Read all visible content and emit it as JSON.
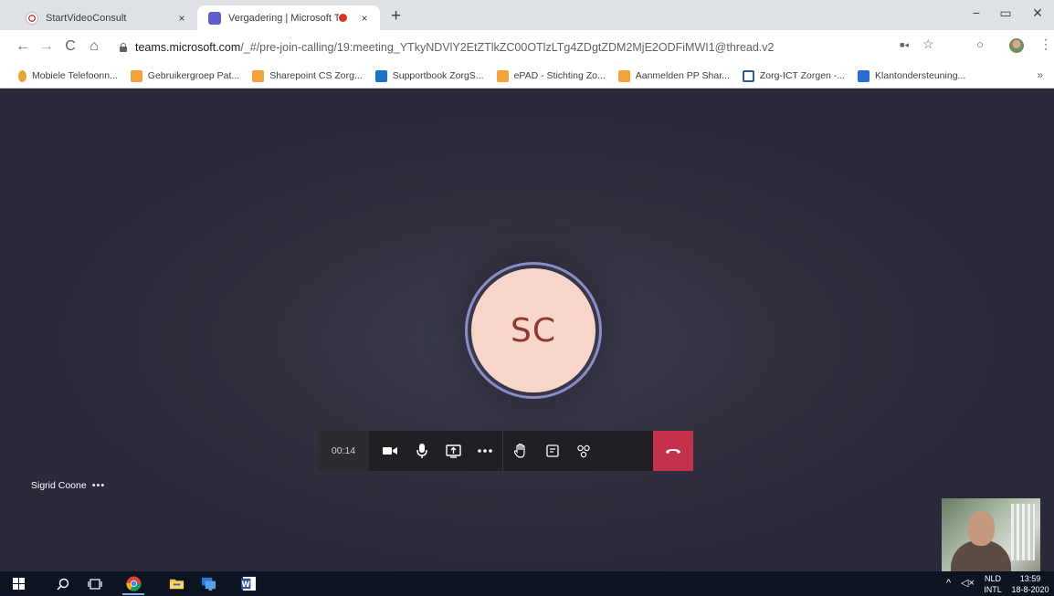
{
  "browser": {
    "tabs": [
      {
        "title": "StartVideoConsult",
        "close": "×",
        "active": false
      },
      {
        "title": "Vergadering | Microsoft Tean",
        "close": "×",
        "active": true
      }
    ],
    "new_tab": "+",
    "window_controls": {
      "minimize": "−",
      "maximize": "▭",
      "close": "✕"
    },
    "nav": {
      "back": "←",
      "forward": "→",
      "reload": "C",
      "home": "⌂"
    },
    "url_host": "teams.microsoft.com",
    "url_path": "/_#/pre-join-calling/19:meeting_YTkyNDVlY2EtZTlkZC00OTlzLTg4ZDgtZDM2MjE2ODFiMWI1@thread.v2",
    "address_icons": {
      "camera": "■◂",
      "star": "☆",
      "extension": "○",
      "menu": "⋮"
    },
    "bookmarks": [
      {
        "label": "Mobiele Telefoonn...",
        "color": "#e8a33a"
      },
      {
        "label": "Gebruikergroep Pat...",
        "color": "#f2a33a"
      },
      {
        "label": "Sharepoint CS Zorg...",
        "color": "#f2a33a"
      },
      {
        "label": "Supportbook ZorgS...",
        "color": "#1a73c8"
      },
      {
        "label": "ePAD - Stichting Zo...",
        "color": "#f2a33a"
      },
      {
        "label": "Aanmelden PP Shar...",
        "color": "#f2a33a"
      },
      {
        "label": "Zorg-ICT Zorgen -...",
        "color": "#2c5aa0"
      },
      {
        "label": "Klantondersteuning...",
        "color": "#2b6cd6"
      }
    ],
    "bookmarks_more": "»"
  },
  "meeting": {
    "avatar_initials": "SC",
    "participant_name": "Sigrid Coone",
    "participant_more": "•••",
    "timer": "00:14",
    "colors": {
      "accent_ring": "#8b8cc7",
      "avatar_bg": "#f9d6cc",
      "avatar_text": "#8b3a33",
      "hangup": "#c4314b"
    }
  },
  "taskbar": {
    "language_top": "NLD",
    "language_bottom": "INTL",
    "time": "13:59",
    "date": "18-8-2020"
  }
}
